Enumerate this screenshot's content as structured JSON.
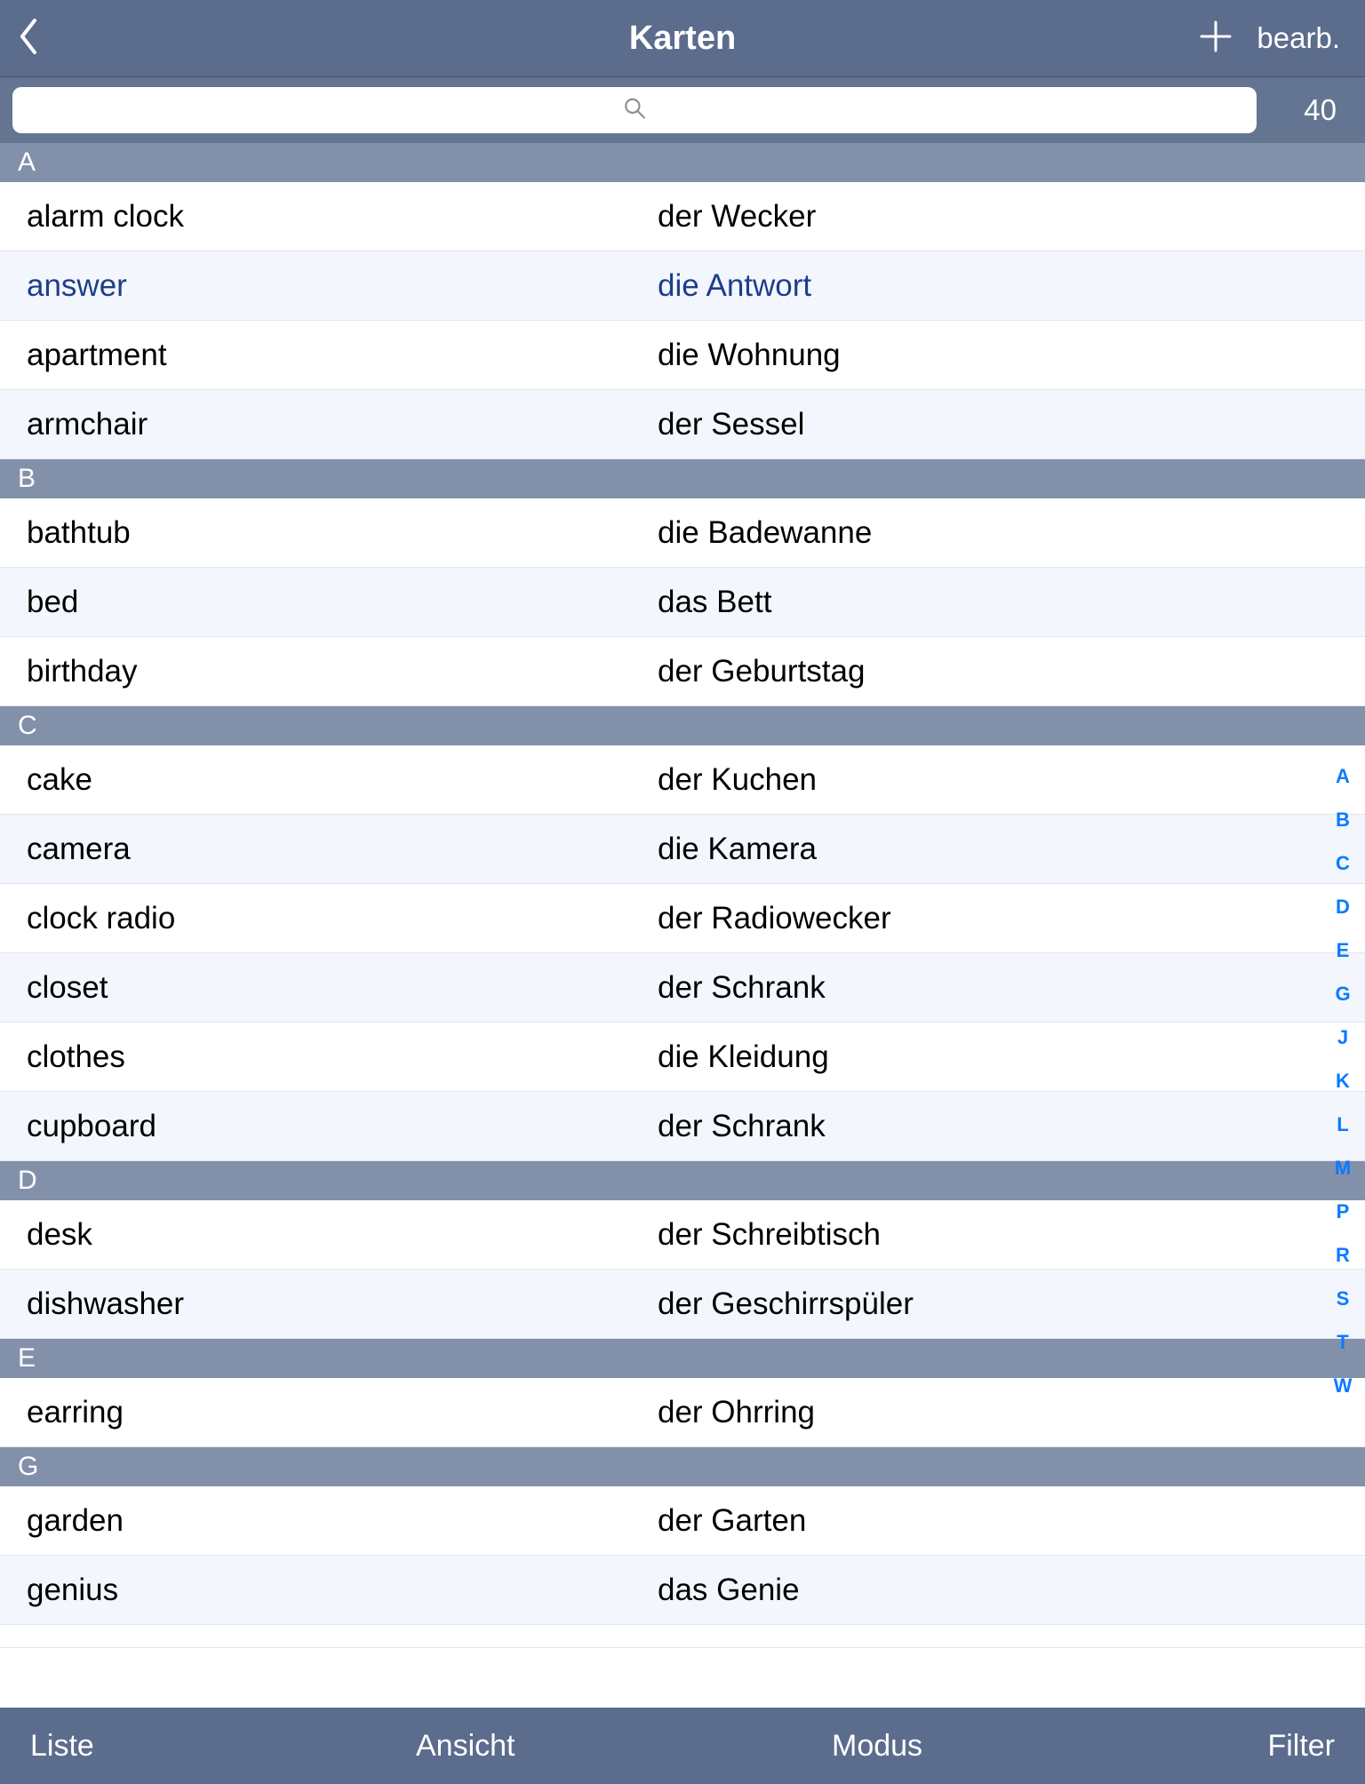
{
  "header": {
    "title": "Karten",
    "edit_label": "bearb."
  },
  "search": {
    "placeholder": "",
    "count": "40"
  },
  "index_strip": [
    "A",
    "B",
    "C",
    "D",
    "E",
    "G",
    "J",
    "K",
    "L",
    "M",
    "P",
    "R",
    "S",
    "T",
    "W"
  ],
  "toolbar": {
    "liste": "Liste",
    "ansicht": "Ansicht",
    "modus": "Modus",
    "filter": "Filter"
  },
  "sections": [
    {
      "letter": "A",
      "rows": [
        {
          "front": "alarm clock",
          "back": "der Wecker",
          "alt": false,
          "selected": false
        },
        {
          "front": "answer",
          "back": "die Antwort",
          "alt": true,
          "selected": true
        },
        {
          "front": "apartment",
          "back": "die Wohnung",
          "alt": false,
          "selected": false
        },
        {
          "front": "armchair",
          "back": "der Sessel",
          "alt": true,
          "selected": false
        }
      ]
    },
    {
      "letter": "B",
      "rows": [
        {
          "front": "bathtub",
          "back": "die Badewanne",
          "alt": false,
          "selected": false
        },
        {
          "front": "bed",
          "back": "das Bett",
          "alt": true,
          "selected": false
        },
        {
          "front": "birthday",
          "back": "der Geburtstag",
          "alt": false,
          "selected": false
        }
      ]
    },
    {
      "letter": "C",
      "rows": [
        {
          "front": "cake",
          "back": "der Kuchen",
          "alt": false,
          "selected": false
        },
        {
          "front": "camera",
          "back": "die Kamera",
          "alt": true,
          "selected": false
        },
        {
          "front": "clock radio",
          "back": "der Radiowecker",
          "alt": false,
          "selected": false
        },
        {
          "front": "closet",
          "back": "der Schrank",
          "alt": true,
          "selected": false
        },
        {
          "front": "clothes",
          "back": "die Kleidung",
          "alt": false,
          "selected": false
        },
        {
          "front": "cupboard",
          "back": "der Schrank",
          "alt": true,
          "selected": false
        }
      ]
    },
    {
      "letter": "D",
      "rows": [
        {
          "front": "desk",
          "back": "der Schreibtisch",
          "alt": false,
          "selected": false
        },
        {
          "front": "dishwasher",
          "back": "der Geschirrspüler",
          "alt": true,
          "selected": false
        }
      ]
    },
    {
      "letter": "E",
      "rows": [
        {
          "front": "earring",
          "back": "der Ohrring",
          "alt": false,
          "selected": false
        }
      ]
    },
    {
      "letter": "G",
      "rows": [
        {
          "front": "garden",
          "back": "der Garten",
          "alt": false,
          "selected": false
        },
        {
          "front": "genius",
          "back": "das Genie",
          "alt": true,
          "selected": false
        }
      ],
      "cut_row": {
        "front": " ",
        "back": " ",
        "alt": false
      }
    }
  ]
}
